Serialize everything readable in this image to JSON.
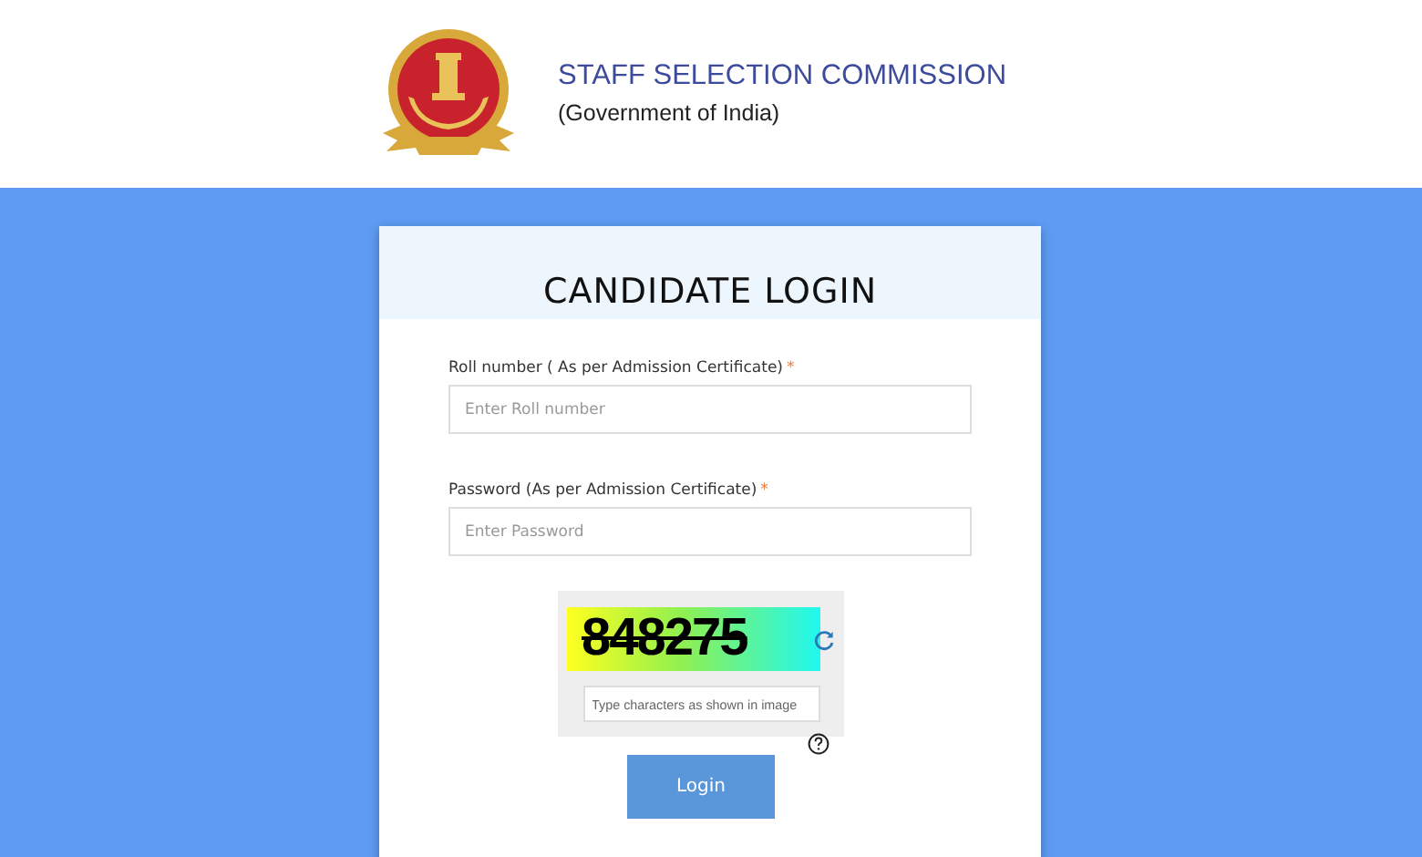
{
  "header": {
    "title": "STAFF SELECTION COMMISSION",
    "subtitle": "(Government of India)"
  },
  "login": {
    "title": "CANDIDATE LOGIN",
    "fields": [
      {
        "label": "Roll number ( As per Admission Certificate)",
        "required_mark": "*",
        "placeholder": "Enter Roll number"
      },
      {
        "label": "Password (As per Admission Certificate)",
        "required_mark": "*",
        "placeholder": "Enter Password"
      }
    ],
    "captcha": {
      "code": "848275",
      "placeholder": "Type characters as shown in image"
    },
    "button": "Login"
  }
}
